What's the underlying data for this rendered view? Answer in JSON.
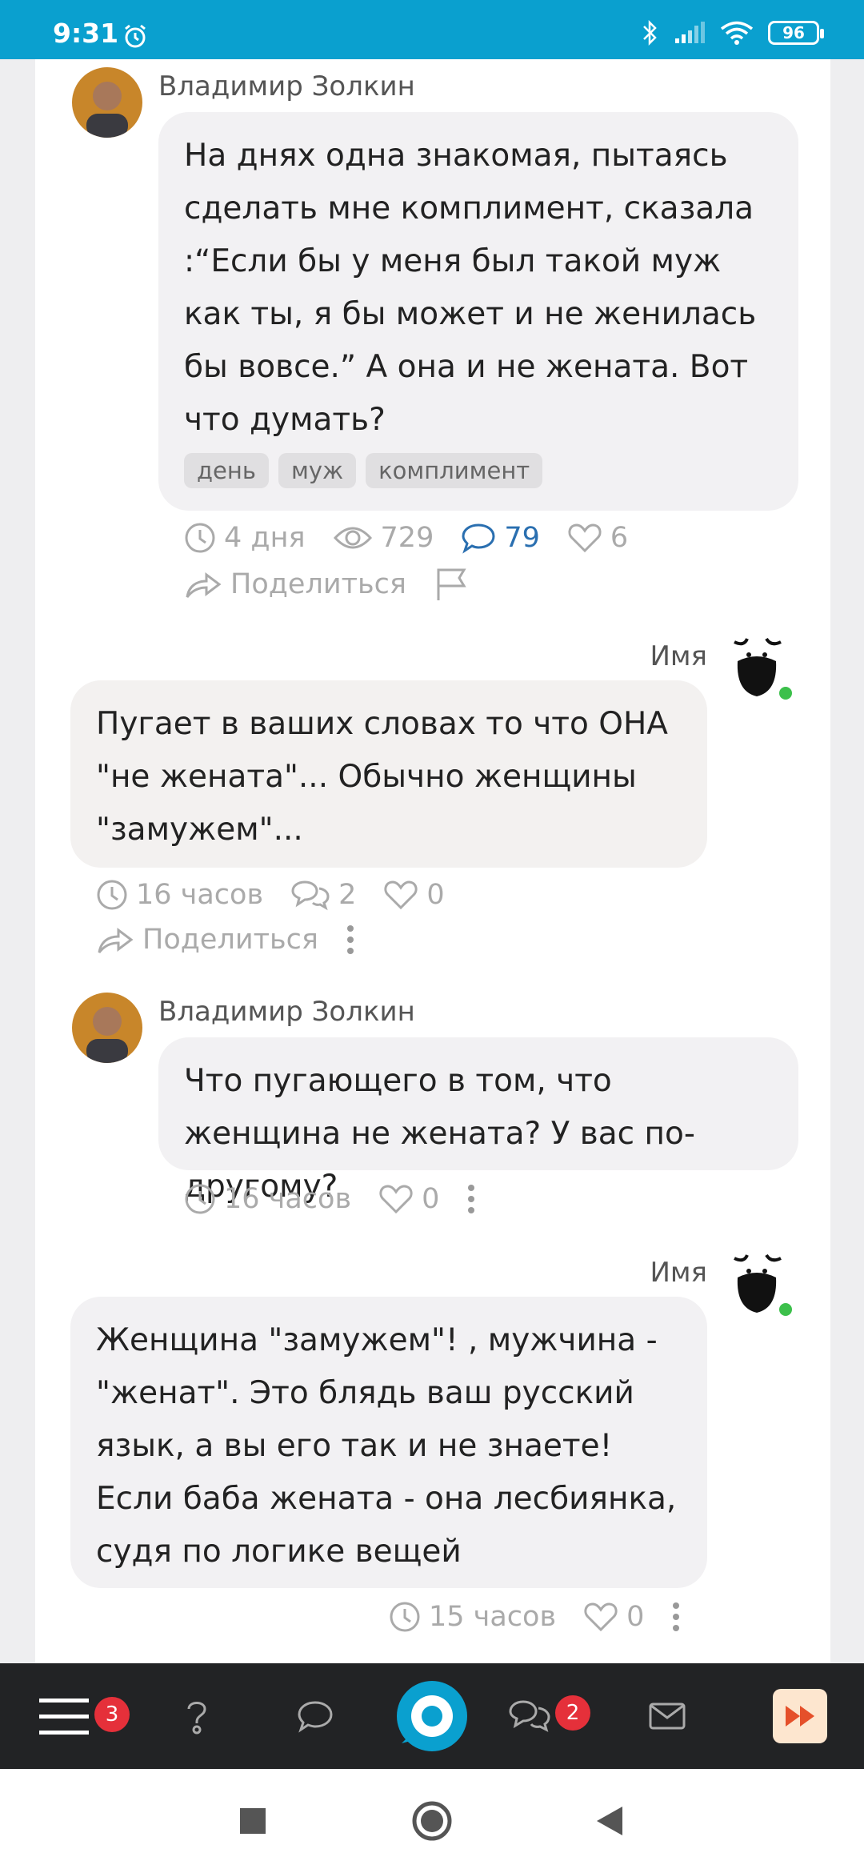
{
  "status_bar": {
    "time": "9:31",
    "battery": "96",
    "icons": [
      "alarm-icon",
      "bluetooth-icon",
      "signal-icon",
      "wifi-icon",
      "battery-icon"
    ]
  },
  "post": {
    "author": "Владимир Золкин",
    "text": "На днях одна знакомая, пытаясь сделать мне комплимент, сказала :“Если бы у меня был такой муж как ты, я бы может и не женилась бы вовсе.” А она и не жената. Вот что думать?",
    "tags": [
      "день",
      "муж",
      "комплимент"
    ],
    "time": "4 дня",
    "views": "729",
    "comments": "79",
    "likes": "6",
    "share_label": "Поделиться"
  },
  "comments": [
    {
      "author": "Имя",
      "text": "Пугает в ваших словах то что ОНА \"не жената\"... Обычно женщины \"замужем\"...",
      "time": "16 часов",
      "replies": "2",
      "likes": "0",
      "share_label": "Поделиться"
    },
    {
      "author": "Владимир Золкин",
      "text": "Что пугающего в том, что женщина не жената? У вас по-другому?",
      "time": "16 часов",
      "likes": "0"
    },
    {
      "author": "Имя",
      "text": "Женщина \"замужем\"! , мужчина - \"женат\". Это блядь ваш русский язык, а вы его так и не знаете! Если баба жената - она лесбиянка, судя по логике вещей",
      "time": "15 часов",
      "likes": "0"
    }
  ],
  "bottom_nav": {
    "menu_badge": "3",
    "messages_badge": "2"
  },
  "colors": {
    "brand": "#0aa0cf",
    "badge": "#e5303a",
    "online": "#3cc04b",
    "link_blue": "#2a6fb0"
  }
}
